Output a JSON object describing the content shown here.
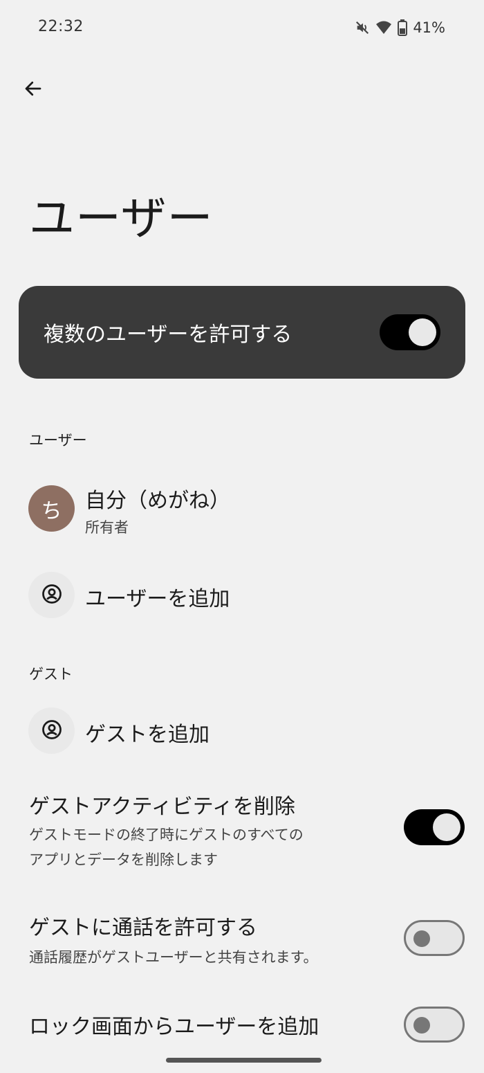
{
  "status_bar": {
    "time": "22:32",
    "battery": "41%",
    "icons": [
      "mute-icon",
      "wifi-icon",
      "battery-icon"
    ]
  },
  "header": {
    "back_icon": "back-arrow-icon",
    "title": "ユーザー"
  },
  "main_toggle": {
    "label": "複数のユーザーを許可する",
    "state": "on"
  },
  "users_section": {
    "header": "ユーザー",
    "current_user": {
      "avatar_initial": "ち",
      "name": "自分（めがね）",
      "role": "所有者",
      "avatar_color": "#8e6f62"
    },
    "add_user": {
      "icon": "account-circle-icon",
      "label": "ユーザーを追加"
    }
  },
  "guest_section": {
    "header": "ゲスト",
    "add_guest": {
      "icon": "account-circle-icon",
      "label": "ゲストを追加"
    },
    "settings": [
      {
        "title": "ゲストアクティビティを削除",
        "subtitle_line1": "ゲストモードの終了時にゲストのすべての",
        "subtitle_line2": "アプリとデータを削除します",
        "state": "on"
      },
      {
        "title": "ゲストに通話を許可する",
        "subtitle_line1": "通話履歴がゲストユーザーと共有されます。",
        "state": "off"
      },
      {
        "title": "ロック画面からユーザーを追加",
        "state": "off"
      }
    ]
  },
  "colors": {
    "background": "#f1f1f1",
    "card": "#3a3a3a",
    "switch_on": "#000000",
    "switch_off_border": "#777777"
  }
}
